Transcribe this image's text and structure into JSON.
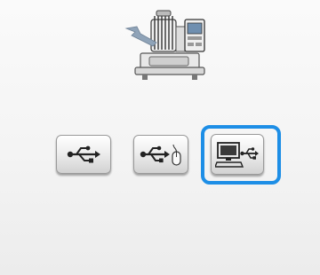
{
  "screen": {
    "machine_illustration": "embroidery-machine-icon",
    "buttons": [
      {
        "name": "usb-media-button",
        "icon": "usb-icon"
      },
      {
        "name": "usb-mouse-button",
        "icon": "usb-mouse-icon"
      },
      {
        "name": "computer-usb-button",
        "icon": "computer-usb-icon",
        "selected": true
      }
    ]
  },
  "colors": {
    "selection_accent": "#1d8ee6",
    "button_face": "#e6e6e6",
    "button_border": "#9a9a9a"
  }
}
